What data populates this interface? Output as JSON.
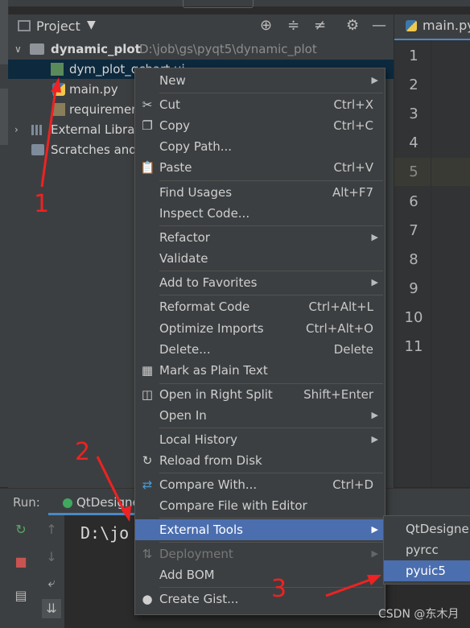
{
  "project_panel": {
    "title": "Project"
  },
  "tree": {
    "root": {
      "name": "dynamic_plot",
      "path": "D:\\job\\gs\\pyqt5\\dynamic_plot"
    },
    "files": [
      {
        "name": "dym_plot_qchart.ui"
      },
      {
        "name": "main.py"
      },
      {
        "name": "requirements.txt"
      }
    ],
    "external": "External Libraries",
    "scratches": "Scratches and Consoles"
  },
  "editor": {
    "tab": "main.py",
    "line_numbers": [
      "1",
      "2",
      "3",
      "4",
      "5",
      "6",
      "7",
      "8",
      "9",
      "10",
      "11"
    ],
    "current_line": "5"
  },
  "run": {
    "label": "Run:",
    "tab": "QtDesigner",
    "console": "D:\\jo"
  },
  "context_menu": {
    "items": [
      {
        "label": "New",
        "shortcut": "",
        "submenu": true
      },
      {
        "label": "Cut",
        "shortcut": "Ctrl+X",
        "icon": "scissors-icon"
      },
      {
        "label": "Copy",
        "shortcut": "Ctrl+C",
        "icon": "copy-icon"
      },
      {
        "label": "Copy Path...",
        "shortcut": ""
      },
      {
        "label": "Paste",
        "shortcut": "Ctrl+V",
        "icon": "clipboard-icon"
      },
      {
        "label": "Find Usages",
        "shortcut": "Alt+F7"
      },
      {
        "label": "Inspect Code...",
        "shortcut": ""
      },
      {
        "label": "Refactor",
        "shortcut": "",
        "submenu": true
      },
      {
        "label": "Validate",
        "shortcut": ""
      },
      {
        "label": "Add to Favorites",
        "shortcut": "",
        "submenu": true
      },
      {
        "label": "Reformat Code",
        "shortcut": "Ctrl+Alt+L"
      },
      {
        "label": "Optimize Imports",
        "shortcut": "Ctrl+Alt+O"
      },
      {
        "label": "Delete...",
        "shortcut": "Delete"
      },
      {
        "label": "Mark as Plain Text",
        "shortcut": "",
        "icon": "text-file-icon"
      },
      {
        "label": "Open in Right Split",
        "shortcut": "Shift+Enter",
        "icon": "split-icon"
      },
      {
        "label": "Open In",
        "shortcut": "",
        "submenu": true
      },
      {
        "label": "Local History",
        "shortcut": "",
        "submenu": true
      },
      {
        "label": "Reload from Disk",
        "shortcut": "",
        "icon": "reload-icon"
      },
      {
        "label": "Compare With...",
        "shortcut": "Ctrl+D",
        "icon": "compare-icon"
      },
      {
        "label": "Compare File with Editor",
        "shortcut": ""
      },
      {
        "label": "External Tools",
        "shortcut": "",
        "submenu": true,
        "highlighted": true
      },
      {
        "label": "Deployment",
        "shortcut": "",
        "submenu": true,
        "disabled": true,
        "icon": "deploy-icon"
      },
      {
        "label": "Add BOM",
        "shortcut": ""
      },
      {
        "label": "Create Gist...",
        "shortcut": "",
        "icon": "github-icon"
      }
    ]
  },
  "submenu": {
    "items": [
      {
        "label": "QtDesigner"
      },
      {
        "label": "pyrcc"
      },
      {
        "label": "pyuic5",
        "highlighted": true
      }
    ]
  },
  "annotations": {
    "step1": "1",
    "step2": "2",
    "step3": "3"
  },
  "watermark": "CSDN @东木月",
  "colors": {
    "highlight": "#4b6eaf",
    "annotation": "#ee2222",
    "panel": "#3c3f41"
  }
}
